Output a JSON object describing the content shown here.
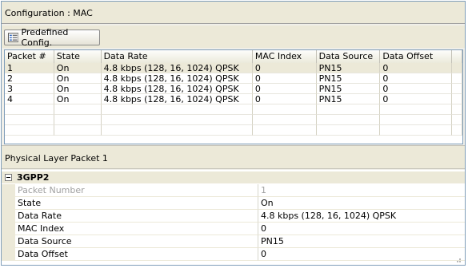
{
  "config_header": {
    "title": "Configuration : MAC"
  },
  "toolbar": {
    "predefined_label": "Predefined Config.",
    "predefined_icon": "config-list-icon"
  },
  "grid": {
    "columns": [
      "Packet #",
      "State",
      "Data Rate",
      "MAC Index",
      "Data Source",
      "Data Offset"
    ],
    "rows": [
      [
        "1",
        "On",
        "4.8 kbps (128, 16, 1024) QPSK",
        "0",
        "PN15",
        "0"
      ],
      [
        "2",
        "On",
        "4.8 kbps (128, 16, 1024) QPSK",
        "0",
        "PN15",
        "0"
      ],
      [
        "3",
        "On",
        "4.8 kbps (128, 16, 1024) QPSK",
        "0",
        "PN15",
        "0"
      ],
      [
        "4",
        "On",
        "4.8 kbps (128, 16, 1024) QPSK",
        "0",
        "PN15",
        "0"
      ]
    ],
    "selected_row": 0
  },
  "physical": {
    "title": "Physical Layer Packet 1"
  },
  "props": {
    "category": "3GPP2",
    "items": [
      {
        "name": "Packet Number",
        "value": "1",
        "disabled": true
      },
      {
        "name": "State",
        "value": "On",
        "disabled": false
      },
      {
        "name": "Data Rate",
        "value": "4.8 kbps (128, 16, 1024) QPSK",
        "disabled": false
      },
      {
        "name": "MAC Index",
        "value": "0",
        "disabled": false
      },
      {
        "name": "Data Source",
        "value": "PN15",
        "disabled": false
      },
      {
        "name": "Data Offset",
        "value": "0",
        "disabled": false
      }
    ]
  },
  "colors": {
    "panel": "#ece9d8",
    "border": "#7f9db9",
    "disabled_text": "#a0a0a0"
  }
}
